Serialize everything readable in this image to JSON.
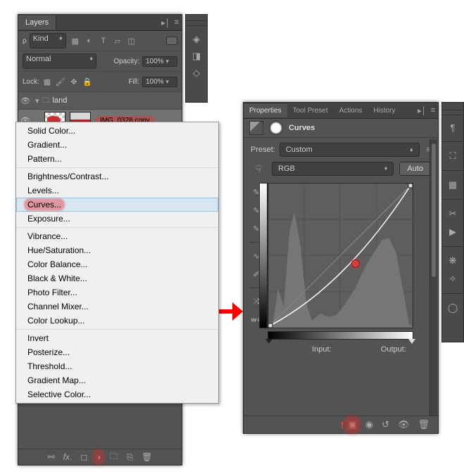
{
  "layers": {
    "tab": "Layers",
    "filter_label": "Kind",
    "blend_mode": "Normal",
    "opacity_label": "Opacity:",
    "opacity_value": "100%",
    "lock_label": "Lock:",
    "fill_label": "Fill:",
    "fill_value": "100%",
    "folder_name": "land",
    "selected_layer": "IMG_0328 copy"
  },
  "menu": {
    "group1": [
      "Solid Color...",
      "Gradient...",
      "Pattern..."
    ],
    "group2": [
      "Brightness/Contrast...",
      "Levels...",
      "Curves...",
      "Exposure..."
    ],
    "group3": [
      "Vibrance...",
      "Hue/Saturation...",
      "Color Balance...",
      "Black & White...",
      "Photo Filter...",
      "Channel Mixer...",
      "Color Lookup..."
    ],
    "group4": [
      "Invert",
      "Posterize...",
      "Threshold...",
      "Gradient Map...",
      "Selective Color..."
    ],
    "highlighted": "Curves..."
  },
  "props": {
    "tabs": [
      "Properties",
      "Tool Preset",
      "Actions",
      "History"
    ],
    "title": "Curves",
    "preset_label": "Preset:",
    "preset_value": "Custom",
    "channel_value": "RGB",
    "auto_label": "Auto",
    "input_label": "Input:",
    "output_label": "Output:"
  },
  "chart_data": {
    "type": "line",
    "title": "Curves",
    "xlabel": "Input",
    "ylabel": "Output",
    "xlim": [
      0,
      255
    ],
    "ylim": [
      0,
      255
    ],
    "series": [
      {
        "name": "curve",
        "points": [
          [
            0,
            0
          ],
          [
            128,
            105
          ],
          [
            255,
            255
          ]
        ]
      }
    ],
    "control_point": [
      128,
      105
    ]
  }
}
